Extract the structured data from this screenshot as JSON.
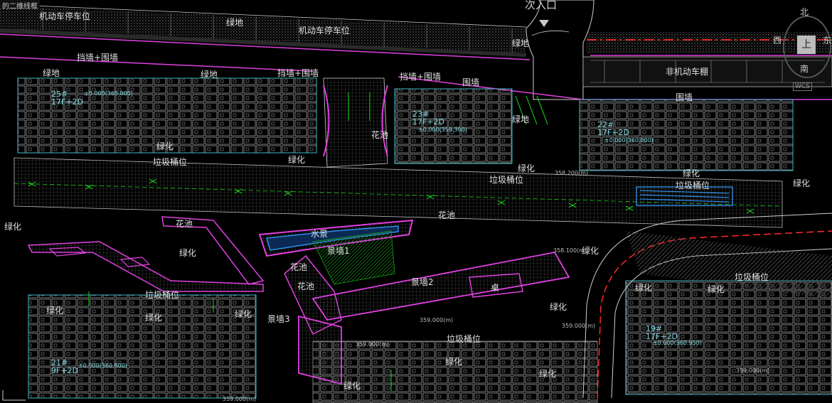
{
  "app": {
    "tab_title": "的二维线框"
  },
  "viewcube": {
    "north": "北",
    "south": "南",
    "west": "西",
    "east": "东",
    "face": "上",
    "wcs": "WCS"
  },
  "labels": {
    "entrance": "次入口",
    "motor_parking_1": "机动车停车位",
    "motor_parking_2": "机动车停车位",
    "nonmotor_shed": "非机动车棚",
    "fence_1": "围墙",
    "fence_2": "围墙",
    "retaining_wall_1": "挡墙+围墙",
    "retaining_wall_2": "挡墙+围墙",
    "retaining_wall_3": "挡墙+围墙",
    "green_1": "绿地",
    "green_2": "绿地",
    "green_3": "绿地",
    "green_4": "绿地",
    "green_5": "绿地",
    "greening_1": "绿化",
    "greening_2": "绿化",
    "greening_3": "绿化",
    "greening_4": "绿化",
    "greening_5": "绿化",
    "greening_6": "绿化",
    "greening_7": "绿化",
    "greening_8": "绿化",
    "greening_9": "绿化",
    "greening_10": "绿化",
    "greening_11": "绿化",
    "greening_12": "绿化",
    "greening_13": "绿化",
    "greening_14": "绿化",
    "greening_15": "绿化",
    "greening_16": "绿化",
    "greening_17": "绿化",
    "flower_1": "花池",
    "flower_2": "花池",
    "flower_3": "花池",
    "flower_4": "花池",
    "flower_5": "花池",
    "trash_1": "垃圾桶位",
    "trash_2": "垃圾桶位",
    "trash_3": "垃圾桶位",
    "trash_4": "垃圾桶位",
    "trash_5": "垃圾桶位",
    "trash_6": "垃圾桶位",
    "water": "水景",
    "feature_1": "景墙1",
    "feature_2": "景墙2",
    "feature_3": "景墙3",
    "table": "桌"
  },
  "buildings": [
    {
      "no": "25#",
      "floors": "17F+2D",
      "elev": "±0.000(360.800)"
    },
    {
      "no": "23#",
      "floors": "17F+2D",
      "elev": "±0.000(359.300)"
    },
    {
      "no": "22#",
      "floors": "17F+2D",
      "elev": "±0.000(360.800)"
    },
    {
      "no": "21#",
      "floors": "9F+2D",
      "elev": "±0.000(360.800)"
    },
    {
      "no": "19#",
      "floors": "17F+2D",
      "elev": "±0.000(360.950)"
    }
  ],
  "levels": {
    "l1": "358.200(m)",
    "l2": "358.100(m)",
    "l3": "359.000(m)",
    "l4": "359.000(m)",
    "l5": "359.000(m)",
    "l6": "359.000(m)",
    "l7": "359.000(m)"
  },
  "colors": {
    "background": "#000000",
    "road_red": "#ff2a2a",
    "boundary_magenta": "#e040e0",
    "building_cyan": "#3fb8c8",
    "annotation_green": "#19e619",
    "water_blue": "#2f8fe8",
    "paving_grey": "#8a8a8a"
  }
}
